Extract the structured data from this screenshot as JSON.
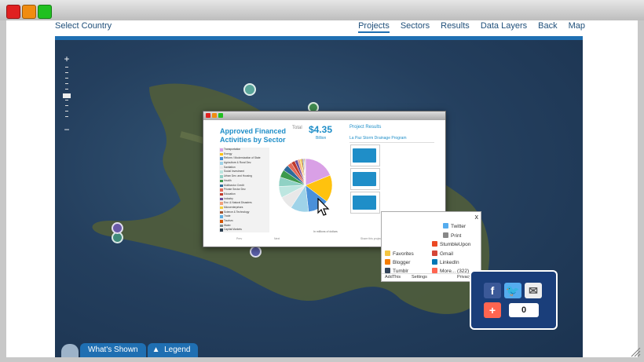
{
  "nav": {
    "select_country": "Select Country",
    "links": [
      "Projects",
      "Sectors",
      "Results",
      "Data Layers",
      "Back",
      "Map"
    ]
  },
  "bottom_tabs": {
    "whats_shown": "What's Shown",
    "legend": "Legend"
  },
  "popup": {
    "title": "Approved Financed Activities by Sector",
    "total_label": "Total",
    "total_value": "$4.35",
    "total_unit": "Billion",
    "unit_note": "In millions of dollars",
    "results_title": "Project Results",
    "project_name": "La Paz Storm Drainage Program",
    "footer_links": [
      "Prev",
      "Next",
      "Share this project",
      "See all stories"
    ]
  },
  "chart_data": {
    "type": "pie",
    "title": "Approved Financed Activities by Sector",
    "categories": [
      "Transportation",
      "Energy",
      "Reform / Modernization of State",
      "Agriculture & Rural Dev.",
      "Sanitation",
      "Social Investment",
      "Urban Dev. and Housing",
      "Health",
      "Multisector Credit",
      "Private Sector Dev.",
      "Education",
      "Industry",
      "Env. & Natural Disasters",
      "Microenterprises",
      "Science & Technology",
      "Trade",
      "Tourism",
      "Water",
      "Capital Markets"
    ],
    "values": [
      820,
      720,
      560,
      480,
      360,
      300,
      250,
      200,
      160,
      120,
      100,
      80,
      60,
      45,
      35,
      25,
      20,
      15,
      10
    ],
    "colors": [
      "#d9a0e6",
      "#ffc20e",
      "#4a90d9",
      "#9fd3e8",
      "#e8e8e8",
      "#bde6e0",
      "#8fd1c4",
      "#3c9a4c",
      "#2d6b9a",
      "#e36b5a",
      "#c0392b",
      "#6b4f9b",
      "#f2a07b",
      "#f4d03f",
      "#a0522d",
      "#5dade2",
      "#d35400",
      "#7f8c8d",
      "#2c3e50"
    ],
    "legend_position": "left"
  },
  "share": {
    "close": "x",
    "items": [
      "Twitter",
      "Print",
      "StumbleUpon",
      "Favorites",
      "Gmail",
      "Blogger",
      "LinkedIn",
      "Tumblr",
      "More... (322)"
    ],
    "footer_left": "AddThis",
    "footer_mid": "Settings",
    "footer_right": "Privacy",
    "count": "0"
  }
}
